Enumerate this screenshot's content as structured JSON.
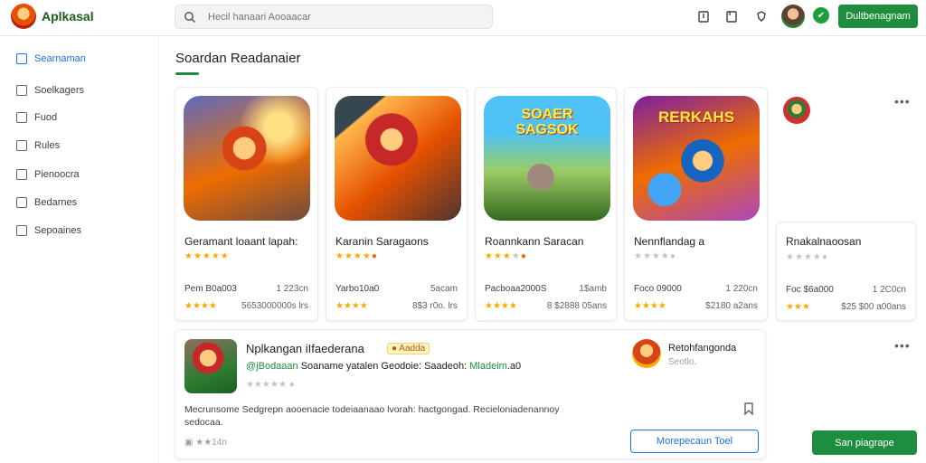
{
  "header": {
    "brand": "Aplkasal",
    "search_placeholder": "Hecil hanaari Aooaacar",
    "action_button": "Dultbenagnam"
  },
  "sidebar": {
    "items": [
      {
        "label": "Searnaman",
        "active": true
      },
      {
        "label": "Soelkagers"
      },
      {
        "label": "Fuod"
      },
      {
        "label": "Rules"
      },
      {
        "label": "Pienoocra"
      },
      {
        "label": "Bedarnes"
      },
      {
        "label": "Sepoaines"
      }
    ]
  },
  "main": {
    "section_title": "Soardan Readanaier",
    "cards": [
      {
        "title": "Geramant loaant lapah:",
        "rating": 5,
        "price": "Pem B0a003",
        "size": "1 223cn",
        "count": "5653000000s lrs"
      },
      {
        "title": "Karanin Saragaons",
        "rating": 4,
        "price": "Yarbo10a0",
        "size": "5acam",
        "count": "8$3 r0o. lrs"
      },
      {
        "title": "Roannkann Saracan",
        "rating": 4,
        "price": "Pacboaa2000S",
        "size": "1$amb",
        "count": "8 $2888 05ans"
      },
      {
        "title": "Nennflandag a",
        "rating": 0,
        "price": "Foco 09000",
        "size": "1 220cn",
        "count": "$2180 a2ans"
      },
      {
        "title": "Rnakalnaoosan",
        "rating": 0,
        "price": "Foc $6a000",
        "size": "1 2C0cn",
        "count": "$25 $00 a00ans"
      }
    ],
    "card_art_titles": [
      "",
      "",
      "SOAER SAGSOK",
      "",
      "RERKAHS"
    ]
  },
  "listing": {
    "title": "Nplkangan iIfaederana",
    "badge": "Aadda",
    "subtitle_green": "@jBodaaan",
    "subtitle_text": "Soaname yatalen Geodoie: Saadeoh:",
    "subtitle_green2": "Mladeim",
    "subtitle_end": ".a0",
    "description": "Mecrunsome Sedgrepn aooenacie todeiaanaao lvorah: hactgongad. Recieloniadenannoy sedocaa.",
    "footer_count": "14n",
    "developer_name": "Retohfangonda",
    "developer_sub": "Seotlo.",
    "button": "Morepecaun Toel"
  },
  "fab": "San piagrape",
  "colors": {
    "brand_green": "#1e8e3e",
    "link_blue": "#1a73e8",
    "star": "#f9ab00"
  }
}
